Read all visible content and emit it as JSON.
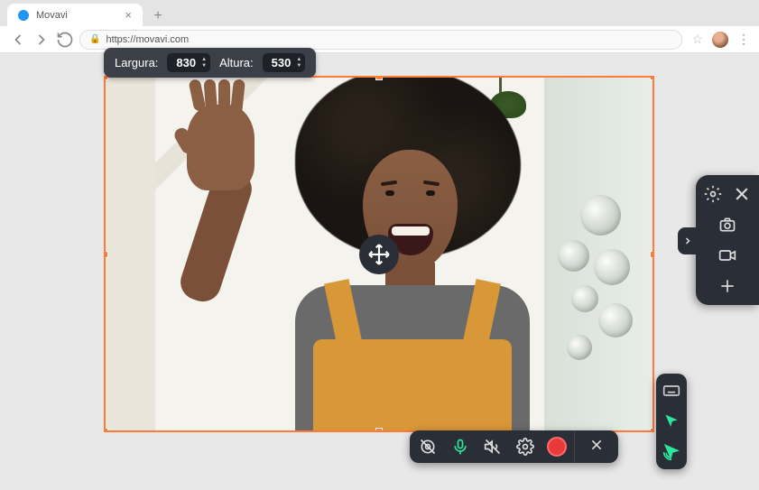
{
  "browser": {
    "tab_title": "Movavi",
    "url": "https://movavi.com"
  },
  "dimension_bar": {
    "width_label": "Largura:",
    "width_value": "830",
    "height_label": "Altura:",
    "height_value": "530"
  },
  "colors": {
    "selection_border": "#ff7b3a",
    "panel_bg": "#2a2e36",
    "accent_green": "#2ae89a",
    "record_red": "#e83a3a"
  }
}
